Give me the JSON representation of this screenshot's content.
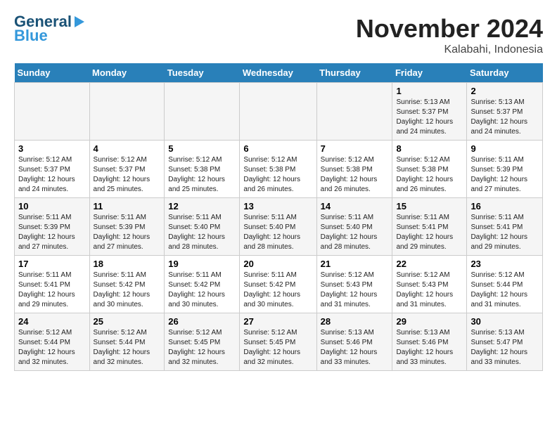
{
  "header": {
    "logo_line1": "General",
    "logo_line2": "Blue",
    "month": "November 2024",
    "location": "Kalabahi, Indonesia"
  },
  "columns": [
    "Sunday",
    "Monday",
    "Tuesday",
    "Wednesday",
    "Thursday",
    "Friday",
    "Saturday"
  ],
  "weeks": [
    [
      {
        "day": "",
        "info": ""
      },
      {
        "day": "",
        "info": ""
      },
      {
        "day": "",
        "info": ""
      },
      {
        "day": "",
        "info": ""
      },
      {
        "day": "",
        "info": ""
      },
      {
        "day": "1",
        "info": "Sunrise: 5:13 AM\nSunset: 5:37 PM\nDaylight: 12 hours\nand 24 minutes."
      },
      {
        "day": "2",
        "info": "Sunrise: 5:13 AM\nSunset: 5:37 PM\nDaylight: 12 hours\nand 24 minutes."
      }
    ],
    [
      {
        "day": "3",
        "info": "Sunrise: 5:12 AM\nSunset: 5:37 PM\nDaylight: 12 hours\nand 24 minutes."
      },
      {
        "day": "4",
        "info": "Sunrise: 5:12 AM\nSunset: 5:37 PM\nDaylight: 12 hours\nand 25 minutes."
      },
      {
        "day": "5",
        "info": "Sunrise: 5:12 AM\nSunset: 5:38 PM\nDaylight: 12 hours\nand 25 minutes."
      },
      {
        "day": "6",
        "info": "Sunrise: 5:12 AM\nSunset: 5:38 PM\nDaylight: 12 hours\nand 26 minutes."
      },
      {
        "day": "7",
        "info": "Sunrise: 5:12 AM\nSunset: 5:38 PM\nDaylight: 12 hours\nand 26 minutes."
      },
      {
        "day": "8",
        "info": "Sunrise: 5:12 AM\nSunset: 5:38 PM\nDaylight: 12 hours\nand 26 minutes."
      },
      {
        "day": "9",
        "info": "Sunrise: 5:11 AM\nSunset: 5:39 PM\nDaylight: 12 hours\nand 27 minutes."
      }
    ],
    [
      {
        "day": "10",
        "info": "Sunrise: 5:11 AM\nSunset: 5:39 PM\nDaylight: 12 hours\nand 27 minutes."
      },
      {
        "day": "11",
        "info": "Sunrise: 5:11 AM\nSunset: 5:39 PM\nDaylight: 12 hours\nand 27 minutes."
      },
      {
        "day": "12",
        "info": "Sunrise: 5:11 AM\nSunset: 5:40 PM\nDaylight: 12 hours\nand 28 minutes."
      },
      {
        "day": "13",
        "info": "Sunrise: 5:11 AM\nSunset: 5:40 PM\nDaylight: 12 hours\nand 28 minutes."
      },
      {
        "day": "14",
        "info": "Sunrise: 5:11 AM\nSunset: 5:40 PM\nDaylight: 12 hours\nand 28 minutes."
      },
      {
        "day": "15",
        "info": "Sunrise: 5:11 AM\nSunset: 5:41 PM\nDaylight: 12 hours\nand 29 minutes."
      },
      {
        "day": "16",
        "info": "Sunrise: 5:11 AM\nSunset: 5:41 PM\nDaylight: 12 hours\nand 29 minutes."
      }
    ],
    [
      {
        "day": "17",
        "info": "Sunrise: 5:11 AM\nSunset: 5:41 PM\nDaylight: 12 hours\nand 29 minutes."
      },
      {
        "day": "18",
        "info": "Sunrise: 5:11 AM\nSunset: 5:42 PM\nDaylight: 12 hours\nand 30 minutes."
      },
      {
        "day": "19",
        "info": "Sunrise: 5:11 AM\nSunset: 5:42 PM\nDaylight: 12 hours\nand 30 minutes."
      },
      {
        "day": "20",
        "info": "Sunrise: 5:11 AM\nSunset: 5:42 PM\nDaylight: 12 hours\nand 30 minutes."
      },
      {
        "day": "21",
        "info": "Sunrise: 5:12 AM\nSunset: 5:43 PM\nDaylight: 12 hours\nand 31 minutes."
      },
      {
        "day": "22",
        "info": "Sunrise: 5:12 AM\nSunset: 5:43 PM\nDaylight: 12 hours\nand 31 minutes."
      },
      {
        "day": "23",
        "info": "Sunrise: 5:12 AM\nSunset: 5:44 PM\nDaylight: 12 hours\nand 31 minutes."
      }
    ],
    [
      {
        "day": "24",
        "info": "Sunrise: 5:12 AM\nSunset: 5:44 PM\nDaylight: 12 hours\nand 32 minutes."
      },
      {
        "day": "25",
        "info": "Sunrise: 5:12 AM\nSunset: 5:44 PM\nDaylight: 12 hours\nand 32 minutes."
      },
      {
        "day": "26",
        "info": "Sunrise: 5:12 AM\nSunset: 5:45 PM\nDaylight: 12 hours\nand 32 minutes."
      },
      {
        "day": "27",
        "info": "Sunrise: 5:12 AM\nSunset: 5:45 PM\nDaylight: 12 hours\nand 32 minutes."
      },
      {
        "day": "28",
        "info": "Sunrise: 5:13 AM\nSunset: 5:46 PM\nDaylight: 12 hours\nand 33 minutes."
      },
      {
        "day": "29",
        "info": "Sunrise: 5:13 AM\nSunset: 5:46 PM\nDaylight: 12 hours\nand 33 minutes."
      },
      {
        "day": "30",
        "info": "Sunrise: 5:13 AM\nSunset: 5:47 PM\nDaylight: 12 hours\nand 33 minutes."
      }
    ]
  ]
}
